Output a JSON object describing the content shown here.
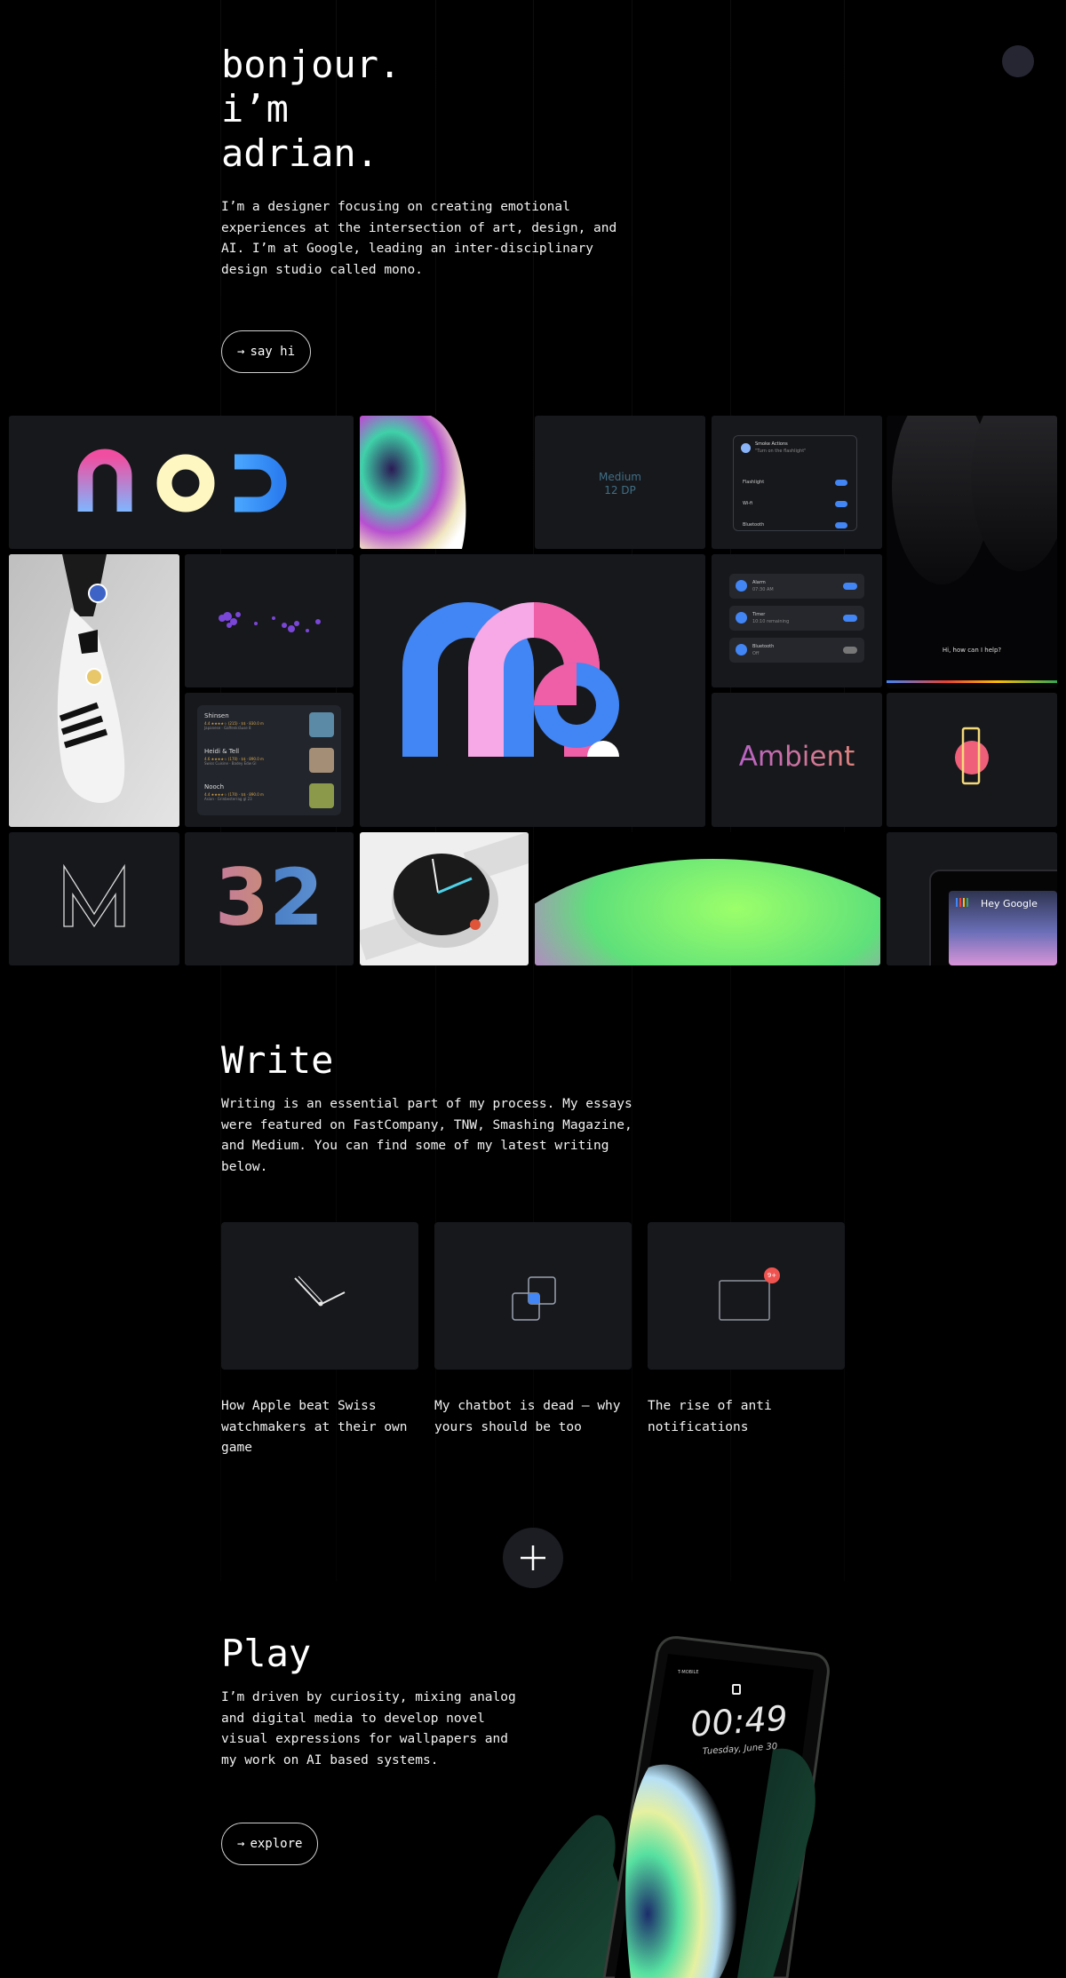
{
  "hero": {
    "greeting_lines": [
      "bonjour.",
      "i’m",
      "adrian."
    ],
    "intro": "I’m a designer focusing on creating emotional experiences at the intersection of art, design, and AI. I’m at Google, leading an inter-disciplinary design studio called mono.",
    "cta_arrow": "→",
    "cta_label": "say hi"
  },
  "grid": {
    "medium_label_1": "Medium",
    "medium_label_2": "12 DP",
    "settings": {
      "title": "Smoke Actions",
      "subtitle": "\"Turn on the flashlight\"",
      "rows": [
        "Flashlight",
        "Wi-fi",
        "Bluetooth"
      ]
    },
    "assistant_prompt": "Hi, how can I help?",
    "alarms": [
      {
        "title": "Alarm",
        "sub": "07:30 AM"
      },
      {
        "title": "Timer",
        "sub": "10:10 remaining"
      },
      {
        "title": "Bluetooth",
        "sub": "Off"
      }
    ],
    "restaurants": [
      {
        "name": "Shinsen",
        "meta": "4.4 ★★★★☆ (215) · $$ · 830.0 m",
        "sub": "Japanese · Gaffenkräuse 8"
      },
      {
        "name": "Heidi & Tell",
        "meta": "4.6 ★★★★☆ (170) · $$ · 890.0 m",
        "sub": "Swiss Cuisine · Badey Edw Gl"
      },
      {
        "name": "Nooch",
        "meta": "4.4 ★★★★☆ (170) · $$ · 890.0 m",
        "sub": "Asian · Grinbesterrag gl 23"
      }
    ],
    "ambient_label": "Ambient",
    "number_label": "32",
    "hey_google": "Hey Google"
  },
  "write": {
    "title": "Write",
    "text": "Writing is an essential part of my process. My essays were featured on FastCompany, TNW, Smashing Magazine, and Medium. You can find some of my latest writing below.",
    "articles": [
      {
        "title": "How Apple beat Swiss watchmakers at their own game",
        "icon": "watch-hands-icon"
      },
      {
        "title": "My chatbot is dead — why yours should be too",
        "icon": "overlap-squares-icon"
      },
      {
        "title": "The rise of anti notifications",
        "icon": "notification-badge-icon",
        "badge": "9+"
      }
    ],
    "more_icon": "plus-icon"
  },
  "play": {
    "title": "Play",
    "text": "I’m driven by curiosity, mixing analog and digital media to develop novel visual expressions for wallpapers and my work on AI based systems.",
    "cta_arrow": "→",
    "cta_label": "explore",
    "phone": {
      "carrier": "T-MOBILE",
      "time": "00:49",
      "date": "Tuesday, June 30"
    }
  },
  "colors": {
    "background": "#000000",
    "tile": "#17181c",
    "blue": "#4285f4",
    "pink": "#ef5fa7",
    "light_pink": "#f7a8e6"
  }
}
